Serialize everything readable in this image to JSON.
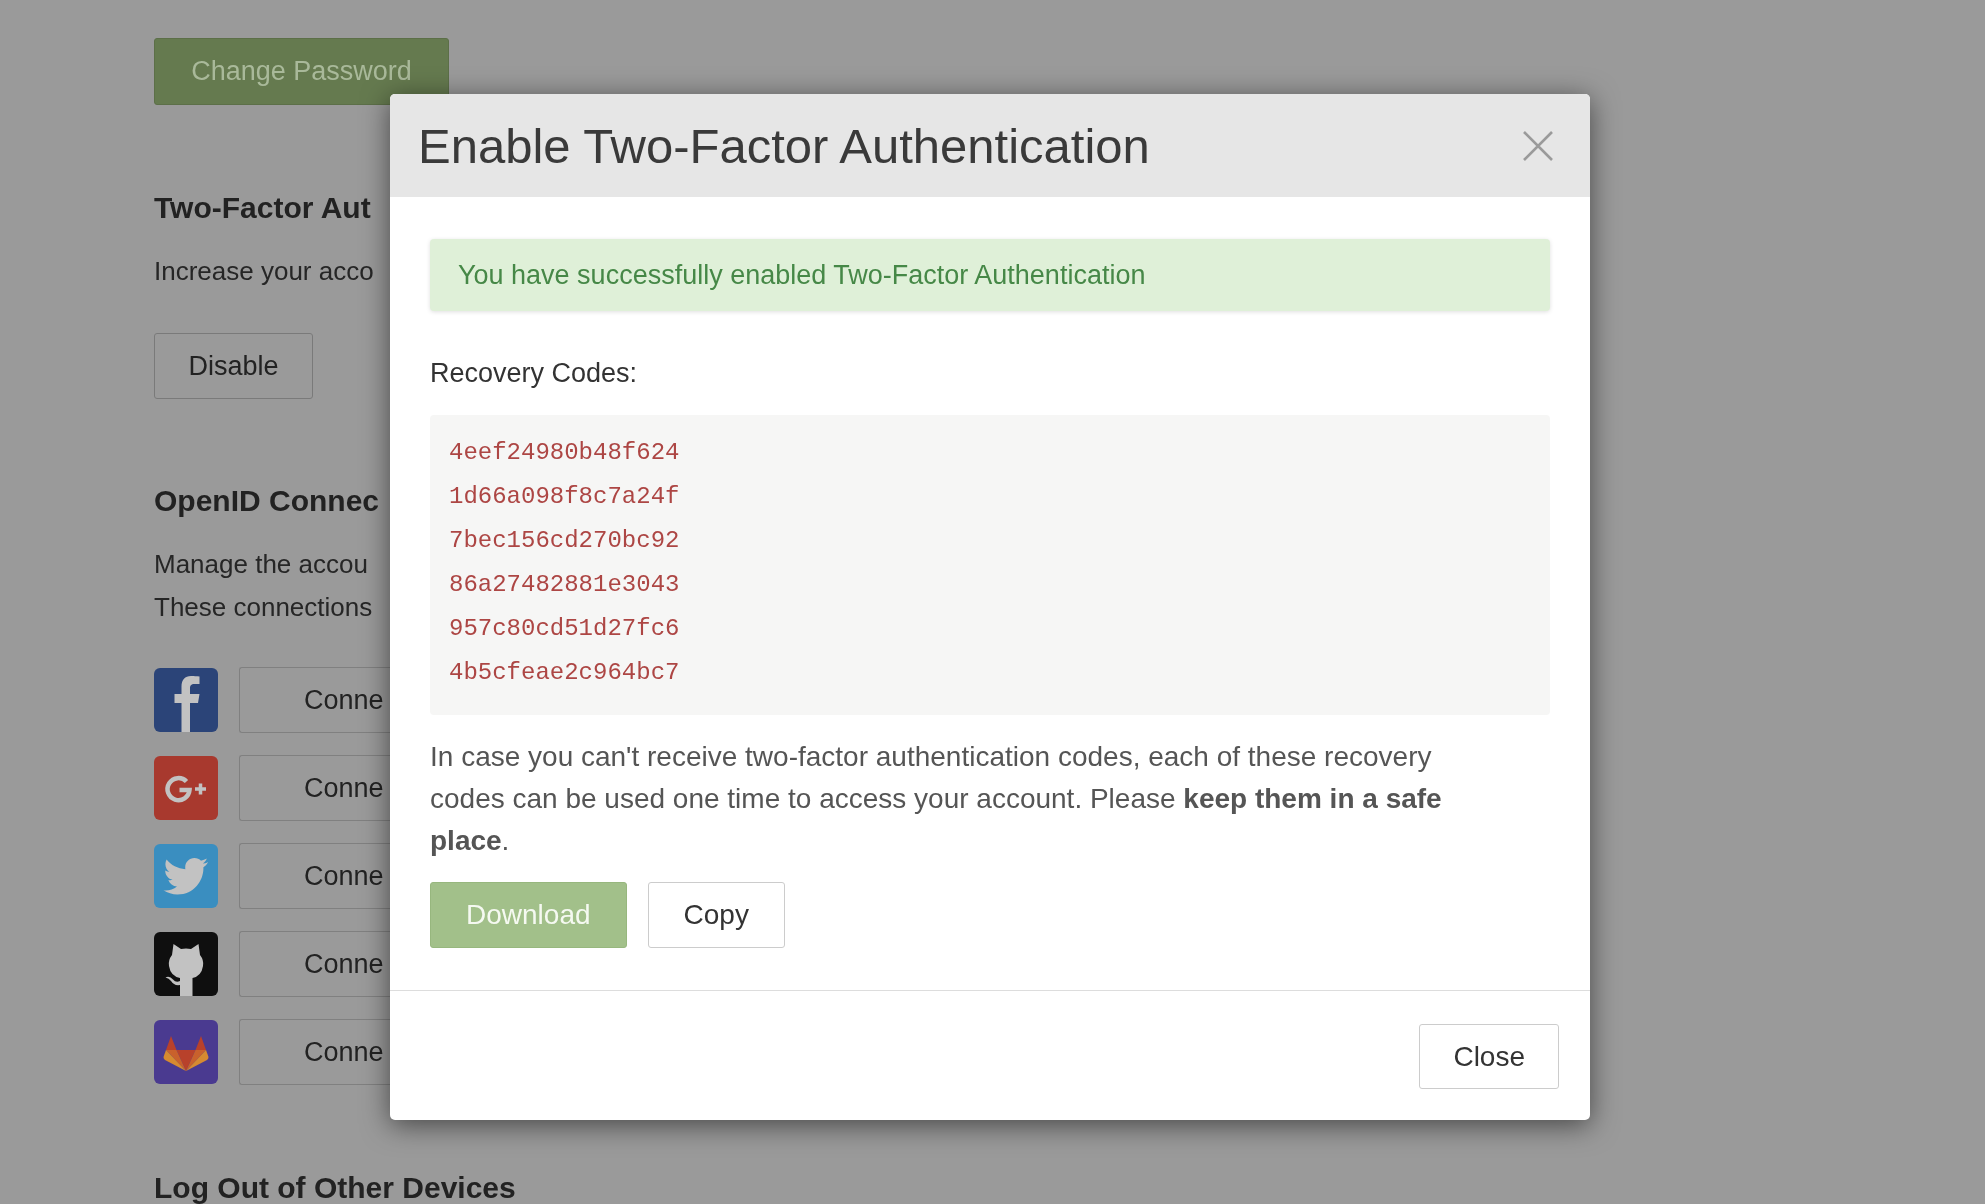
{
  "background_page": {
    "change_password_button": "Change Password",
    "two_factor_section": {
      "heading": "Two-Factor Aut",
      "description": "Increase your acco",
      "disable_button": "Disable"
    },
    "openid_section": {
      "heading": "OpenID Connec",
      "description_lines": [
        "Manage the accou",
        "These connections"
      ],
      "providers": [
        {
          "kind": "f",
          "button": "Conne"
        },
        {
          "kind": "gplus",
          "button": "Conne"
        },
        {
          "kind": "bird",
          "button": "Conne"
        },
        {
          "kind": "cat",
          "button": "Conne"
        },
        {
          "kind": "fox",
          "button": "Conne"
        }
      ]
    },
    "logout_section": {
      "heading": "Log Out of Other Devices"
    }
  },
  "modal": {
    "title": "Enable Two-Factor Authentication",
    "alert": "You have successfully enabled Two-Factor Authentication",
    "recovery_codes_label": "Recovery Codes:",
    "recovery_codes": [
      "4eef24980b48f624",
      "1d66a098f8c7a24f",
      "7bec156cd270bc92",
      "86a27482881e3043",
      "957c80cd51d27fc6",
      "4b5cfeae2c964bc7"
    ],
    "note": "In case you can't receive two-factor authentication codes, each of these recovery codes can be used one time to access your account. Please **keep them in a safe place**.",
    "actions": [
      {
        "kind": "primary",
        "label": "Download"
      },
      {
        "kind": "default",
        "label": "Copy"
      }
    ],
    "footer_button": "Close"
  }
}
